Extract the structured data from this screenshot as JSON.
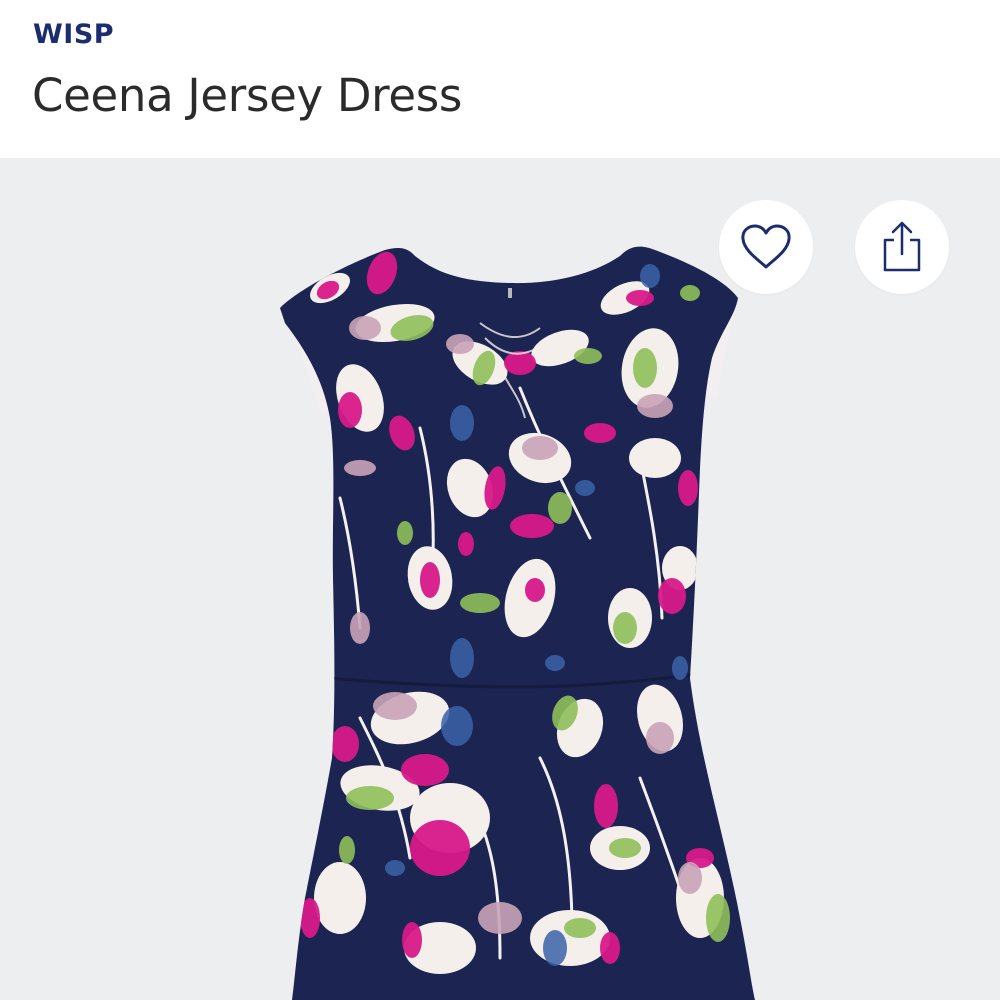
{
  "header": {
    "brand": "WISP",
    "title": "Ceena Jersey Dress"
  },
  "gallery": {
    "favorite_icon": "heart-icon",
    "share_icon": "share-icon"
  },
  "colors": {
    "brand_text": "#1b2d6e",
    "title_text": "#2b2b2b",
    "gallery_background": "#edeef0",
    "dress_navy": "#1c2551",
    "print_magenta": "#d8198a",
    "print_green": "#8fbf5a",
    "print_mauve": "#c9a3b8",
    "print_blue": "#3a63a8",
    "icon_stroke": "#1b2d6e"
  }
}
